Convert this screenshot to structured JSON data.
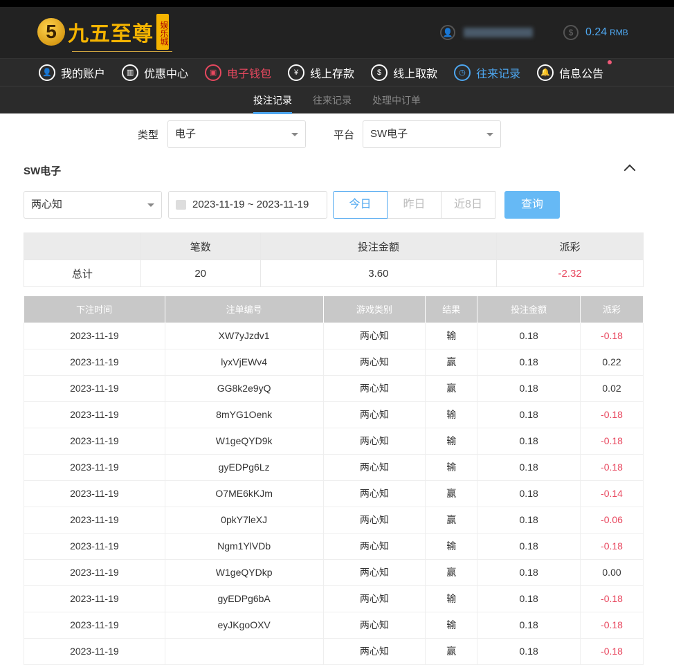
{
  "header": {
    "logo_text": "九五至尊",
    "logo_sub": "娱乐城",
    "logo_badge": "5",
    "balance": "0.24",
    "currency": "RMB"
  },
  "nav": [
    {
      "label": "我的账户",
      "icon": "user-icon"
    },
    {
      "label": "优惠中心",
      "icon": "gift-icon"
    },
    {
      "label": "电子钱包",
      "icon": "wallet-icon"
    },
    {
      "label": "线上存款",
      "icon": "deposit-icon"
    },
    {
      "label": "线上取款",
      "icon": "withdraw-icon"
    },
    {
      "label": "往来记录",
      "icon": "records-icon"
    },
    {
      "label": "信息公告",
      "icon": "bell-icon"
    }
  ],
  "subtabs": [
    "投注记录",
    "往来记录",
    "处理中订单"
  ],
  "filters": {
    "type_label": "类型",
    "type_value": "电子",
    "platform_label": "平台",
    "platform_value": "SW电子"
  },
  "section_title": "SW电子",
  "game_value": "两心知",
  "date_range": "2023-11-19 ~ 2023-11-19",
  "quick": [
    "今日",
    "昨日",
    "近8日"
  ],
  "query": "查询",
  "summary": {
    "headers": [
      "",
      "笔数",
      "投注金额",
      "派彩"
    ],
    "label": "总计",
    "count": "20",
    "amount": "3.60",
    "payout": "-2.32"
  },
  "table": {
    "headers": [
      "下注时间",
      "注单编号",
      "游戏类别",
      "结果",
      "投注金额",
      "派彩"
    ],
    "rows": [
      [
        "2023-11-19",
        "XW7yJzdv1",
        "两心知",
        "输",
        "0.18",
        "-0.18"
      ],
      [
        "2023-11-19",
        "lyxVjEWv4",
        "两心知",
        "赢",
        "0.18",
        "0.22"
      ],
      [
        "2023-11-19",
        "GG8k2e9yQ",
        "两心知",
        "赢",
        "0.18",
        "0.02"
      ],
      [
        "2023-11-19",
        "8mYG1Oenk",
        "两心知",
        "输",
        "0.18",
        "-0.18"
      ],
      [
        "2023-11-19",
        "W1geQYD9k",
        "两心知",
        "输",
        "0.18",
        "-0.18"
      ],
      [
        "2023-11-19",
        "gyEDPg6Lz",
        "两心知",
        "输",
        "0.18",
        "-0.18"
      ],
      [
        "2023-11-19",
        "O7ME6kKJm",
        "两心知",
        "赢",
        "0.18",
        "-0.14"
      ],
      [
        "2023-11-19",
        "0pkY7leXJ",
        "两心知",
        "赢",
        "0.18",
        "-0.06"
      ],
      [
        "2023-11-19",
        "Ngm1YlVDb",
        "两心知",
        "输",
        "0.18",
        "-0.18"
      ],
      [
        "2023-11-19",
        "W1geQYDkp",
        "两心知",
        "赢",
        "0.18",
        "0.00"
      ],
      [
        "2023-11-19",
        "gyEDPg6bA",
        "两心知",
        "输",
        "0.18",
        "-0.18"
      ],
      [
        "2023-11-19",
        "eyJKgoOXV",
        "两心知",
        "输",
        "0.18",
        "-0.18"
      ],
      [
        "2023-11-19",
        "",
        "两心知",
        "赢",
        "0.18",
        "-0.18"
      ]
    ]
  }
}
